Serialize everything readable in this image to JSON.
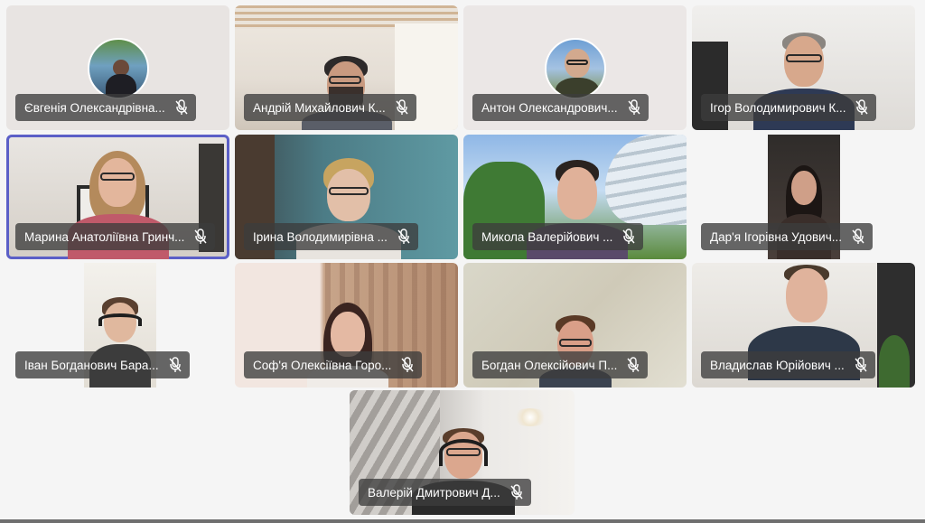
{
  "participants": [
    {
      "name": "Євгенія Олександрівна...",
      "muted": true,
      "active": false,
      "video": "avatar"
    },
    {
      "name": "Андрій Михайлович К...",
      "muted": true,
      "active": false,
      "video": "camera"
    },
    {
      "name": "Антон Олександрович...",
      "muted": true,
      "active": false,
      "video": "avatar"
    },
    {
      "name": "Ігор Володимирович К...",
      "muted": true,
      "active": false,
      "video": "camera"
    },
    {
      "name": "Марина Анатоліївна Гринч...",
      "muted": true,
      "active": true,
      "video": "camera"
    },
    {
      "name": "Ірина Володимирівна ...",
      "muted": true,
      "active": false,
      "video": "camera"
    },
    {
      "name": "Микола Валерійович ...",
      "muted": true,
      "active": false,
      "video": "camera"
    },
    {
      "name": "Дар'я Ігорівна Удович...",
      "muted": true,
      "active": false,
      "video": "camera"
    },
    {
      "name": "Іван Богданович Бара...",
      "muted": true,
      "active": false,
      "video": "camera"
    },
    {
      "name": "Соф'я Олексіївна Горо...",
      "muted": true,
      "active": false,
      "video": "camera"
    },
    {
      "name": "Богдан Олексійович П...",
      "muted": true,
      "active": false,
      "video": "camera"
    },
    {
      "name": "Владислав Юрійович ...",
      "muted": true,
      "active": false,
      "video": "camera"
    },
    {
      "name": "Валерій Дмитрович Д...",
      "muted": true,
      "active": false,
      "video": "camera"
    }
  ],
  "colors": {
    "active_outline": "#5b5fc7",
    "label_bg": "#3c3c3c",
    "page_bg": "#f5f5f5"
  },
  "icons": {
    "mic": "mic-off-icon"
  }
}
